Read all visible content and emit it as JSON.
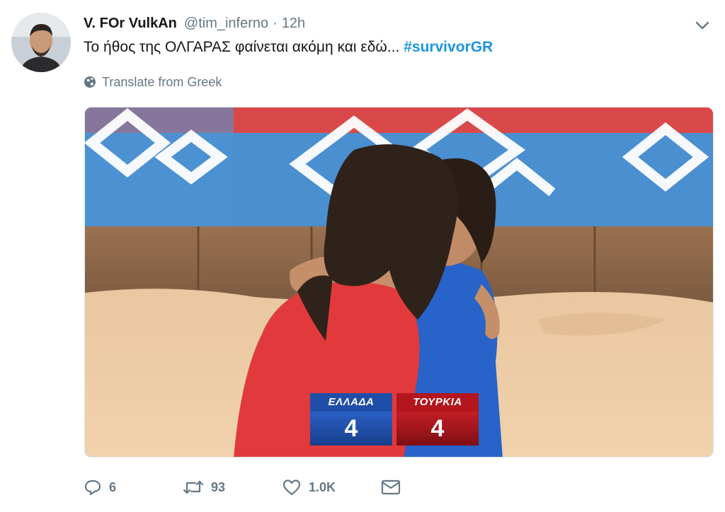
{
  "tweet": {
    "author": {
      "display_name": "V. FOr VulkAn",
      "handle": "@tim_inferno",
      "avatar_icon": "user-avatar"
    },
    "time_separator": "·",
    "time": "12h",
    "text": "Το ήθος της ΟΛΓΑΡΑΣ φαίνεται ακόμη και εδώ...",
    "hashtag": "#survivorGR",
    "translate_label": "Translate from Greek",
    "menu_icon": "chevron-down-icon",
    "media": {
      "scoreboard": {
        "home_team": "ΕΛΛΑΔΑ",
        "home_score": "4",
        "away_team": "ΤΟΥΡΚΙΑ",
        "away_score": "4"
      }
    },
    "actions": {
      "replies": "6",
      "retweets": "93",
      "likes": "1.0K",
      "message_icon": "envelope-icon"
    },
    "colors": {
      "hashtag": "#1b95e0",
      "secondary_text": "#657786",
      "brand_red": "#d3232a",
      "home_team": "#1e4ea8",
      "away_team": "#b3161c"
    }
  }
}
